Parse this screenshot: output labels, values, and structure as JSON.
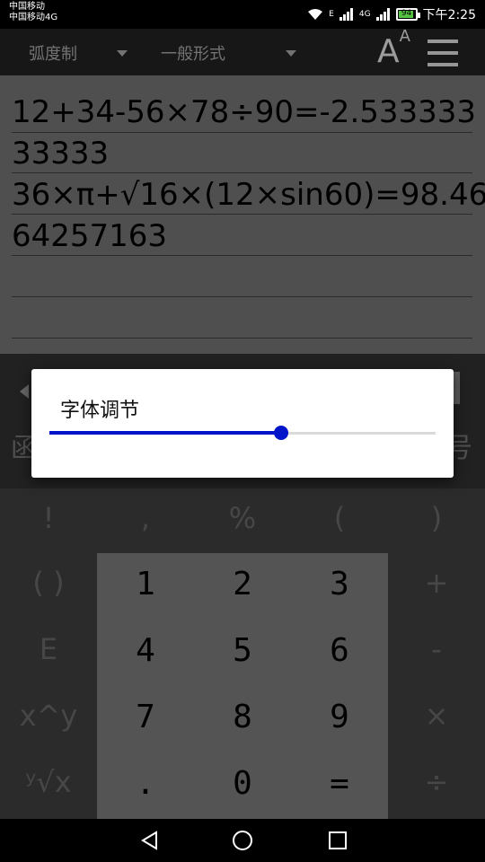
{
  "status": {
    "carrier1": "中国移动",
    "carrier2": "中国移动4G",
    "net1": "E",
    "net2": "4G",
    "battery": "94",
    "time": "下午2:25"
  },
  "toolbar": {
    "angle_mode": "弧度制",
    "format_mode": "一般形式",
    "font_icon_label": "A",
    "font_icon_sup": "A"
  },
  "history": [
    "12+34-56×78÷90=-2.533333",
    "33333",
    "36×π+√16×(12×sin60)=98.46",
    "64257163"
  ],
  "band": {
    "partial_left": "函",
    "partial_right": "号"
  },
  "keypad": {
    "rows": [
      [
        "!",
        ",",
        "%",
        "(",
        ")"
      ],
      [
        "( )",
        "1",
        "2",
        "3",
        "+"
      ],
      [
        "E",
        "4",
        "5",
        "6",
        "-"
      ],
      [
        "x^y",
        "7",
        "8",
        "9",
        "×"
      ],
      [
        "ʸ√x",
        ".",
        "0",
        "=",
        "÷"
      ]
    ]
  },
  "dialog": {
    "title": "字体调节",
    "slider_fraction": 0.6
  },
  "colors": {
    "accent": "#0015c9",
    "battery": "#54c341"
  }
}
